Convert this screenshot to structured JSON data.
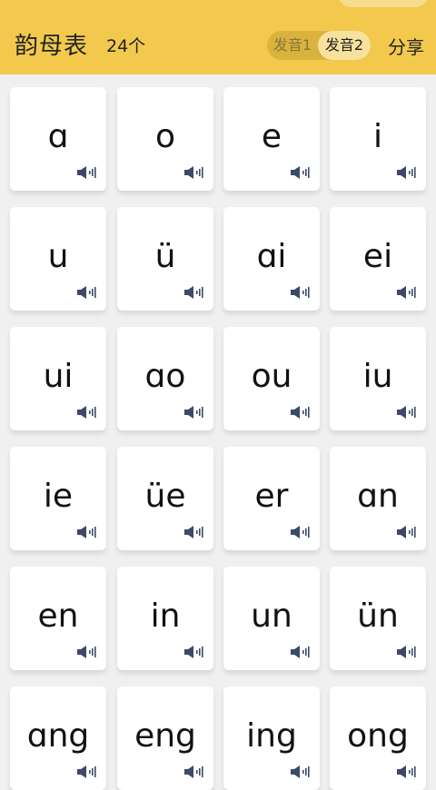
{
  "header": {
    "title": "韵母表",
    "count": "24个",
    "toggle": {
      "option1": "发音1",
      "option2": "发音2",
      "selected": "发音2"
    },
    "share_label": "分享"
  },
  "icons": {
    "speaker": "speaker-icon"
  },
  "colors": {
    "header_bg": "#f2c94c",
    "speaker": "#3b4a66"
  },
  "finals": [
    "ɑ",
    "o",
    "e",
    "i",
    "u",
    "ü",
    "ɑi",
    "ei",
    "ui",
    "ɑo",
    "ou",
    "iu",
    "ie",
    "üe",
    "er",
    "ɑn",
    "en",
    "in",
    "un",
    "ün",
    "ɑng",
    "eng",
    "ing",
    "ong"
  ]
}
